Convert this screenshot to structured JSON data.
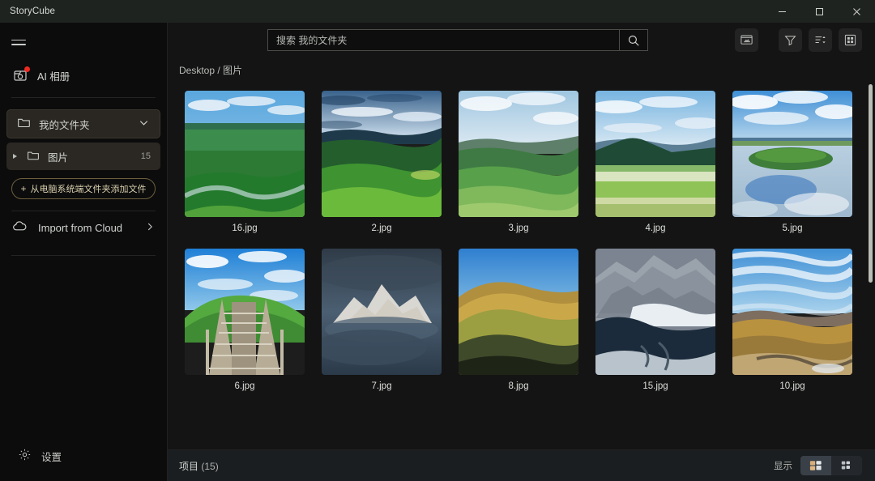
{
  "window": {
    "title": "StoryCube",
    "controls": [
      {
        "name": "minimize-button",
        "glyph": "minimize-icon"
      },
      {
        "name": "maximize-button",
        "glyph": "maximize-icon"
      },
      {
        "name": "close-button",
        "glyph": "close-icon"
      }
    ]
  },
  "sidebar": {
    "menu_icon": "hamburger-icon",
    "ai_album": {
      "label": "AI 相册",
      "icon": "ai-album-icon",
      "badge": true
    },
    "my_folder": {
      "label": "我的文件夹",
      "icon": "folder-icon",
      "chevron": "chevron-down-icon"
    },
    "sub_folder": {
      "label": "图片",
      "icon": "folder-icon",
      "count": "15",
      "expander": "triangle-right-icon"
    },
    "add_files_button": {
      "label": "从电脑系统端文件夹添加文件",
      "plus": "+"
    },
    "import_cloud": {
      "label": "Import from Cloud",
      "icon": "cloud-icon",
      "chevron": "chevron-right-icon"
    },
    "settings": {
      "label": "设置",
      "icon": "gear-icon"
    }
  },
  "toolbar": {
    "search": {
      "placeholder": "搜索 我的文件夹",
      "value": "",
      "button_icon": "search-icon"
    },
    "buttons": [
      {
        "name": "slideshow-button",
        "icon": "slideshow-icon"
      },
      {
        "name": "filter-button",
        "icon": "filter-icon"
      },
      {
        "name": "sort-button",
        "icon": "sort-icon"
      },
      {
        "name": "grid-view-button",
        "icon": "grid-icon"
      }
    ]
  },
  "breadcrumb": {
    "text": "Desktop / 图片"
  },
  "gallery": {
    "items": [
      {
        "name": "16.jpg",
        "scene": "green-plain-river"
      },
      {
        "name": "2.jpg",
        "scene": "green-hills-clouds"
      },
      {
        "name": "3.jpg",
        "scene": "rolling-green-hills"
      },
      {
        "name": "4.jpg",
        "scene": "grassland-mountains"
      },
      {
        "name": "5.jpg",
        "scene": "lake-reflection"
      },
      {
        "name": "6.jpg",
        "scene": "wooden-stairway-hill"
      },
      {
        "name": "7.jpg",
        "scene": "snow-peak-mist"
      },
      {
        "name": "8.jpg",
        "scene": "golden-hillside"
      },
      {
        "name": "15.jpg",
        "scene": "glacier-valley"
      },
      {
        "name": "10.jpg",
        "scene": "autumn-valley-road"
      }
    ]
  },
  "statusbar": {
    "items_label": "项目",
    "items_count": "(15)",
    "display_label": "显示",
    "view_modes": [
      {
        "name": "large-thumbnails-view",
        "icon": "large-tiles-icon",
        "active": true
      },
      {
        "name": "small-thumbnails-view",
        "icon": "small-tiles-icon",
        "active": false
      }
    ]
  },
  "colors": {
    "accent_badge": "#ee2a22",
    "add_button_border": "#6d5f3d",
    "selected_nav": "#2a2722",
    "titlebar": "#1f2320",
    "statusbar": "#1b1e21"
  }
}
